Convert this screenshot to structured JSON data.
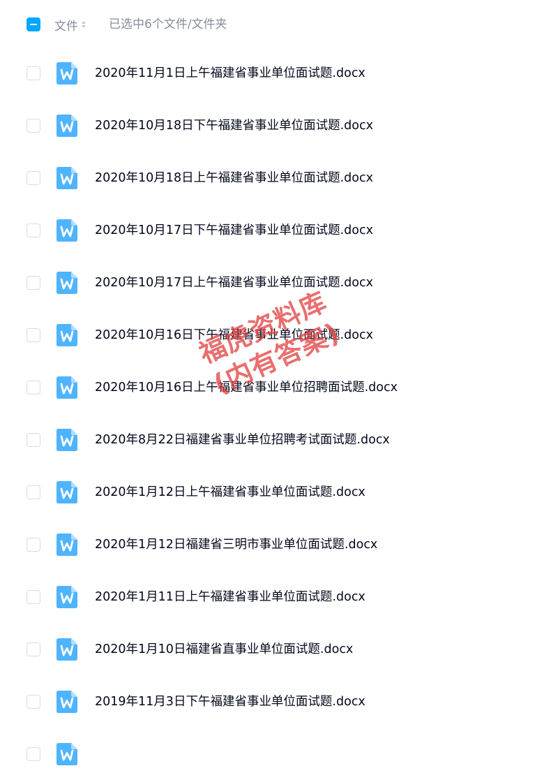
{
  "header": {
    "column_label": "文件",
    "selection_status": "已选中6个文件/文件夹",
    "select_all_state": "partial"
  },
  "colors": {
    "accent": "#06a7ff",
    "doc_icon": "#4fb4ff",
    "text": "#03081a",
    "muted_text": "#878c9c"
  },
  "files": [
    {
      "name": "2020年11月1日上午福建省事业单位面试题.docx",
      "icon": "word-doc-icon"
    },
    {
      "name": "2020年10月18日下午福建省事业单位面试题.docx",
      "icon": "word-doc-icon"
    },
    {
      "name": "2020年10月18日上午福建省事业单位面试题.docx",
      "icon": "word-doc-icon"
    },
    {
      "name": "2020年10月17日下午福建省事业单位面试题.docx",
      "icon": "word-doc-icon"
    },
    {
      "name": "2020年10月17日上午福建省事业单位面试题.docx",
      "icon": "word-doc-icon"
    },
    {
      "name": "2020年10月16日下午福建省事业单位面试题.docx",
      "icon": "word-doc-icon"
    },
    {
      "name": "2020年10月16日上午福建省事业单位招聘面试题.docx",
      "icon": "word-doc-icon"
    },
    {
      "name": "2020年8月22日福建省事业单位招聘考试面试题.docx",
      "icon": "word-doc-icon"
    },
    {
      "name": "2020年1月12日上午福建省事业单位面试题.docx",
      "icon": "word-doc-icon"
    },
    {
      "name": "2020年1月12日福建省三明市事业单位面试题.docx",
      "icon": "word-doc-icon"
    },
    {
      "name": "2020年1月11日上午福建省事业单位面试题.docx",
      "icon": "word-doc-icon"
    },
    {
      "name": "2020年1月10日福建省直事业单位面试题.docx",
      "icon": "word-doc-icon"
    },
    {
      "name": "2019年11月3日下午福建省事业单位面试题.docx",
      "icon": "word-doc-icon"
    },
    {
      "name": "",
      "icon": "word-doc-icon"
    }
  ],
  "watermark": {
    "line1": "福虎资料库",
    "line2": "(内有答案)"
  }
}
